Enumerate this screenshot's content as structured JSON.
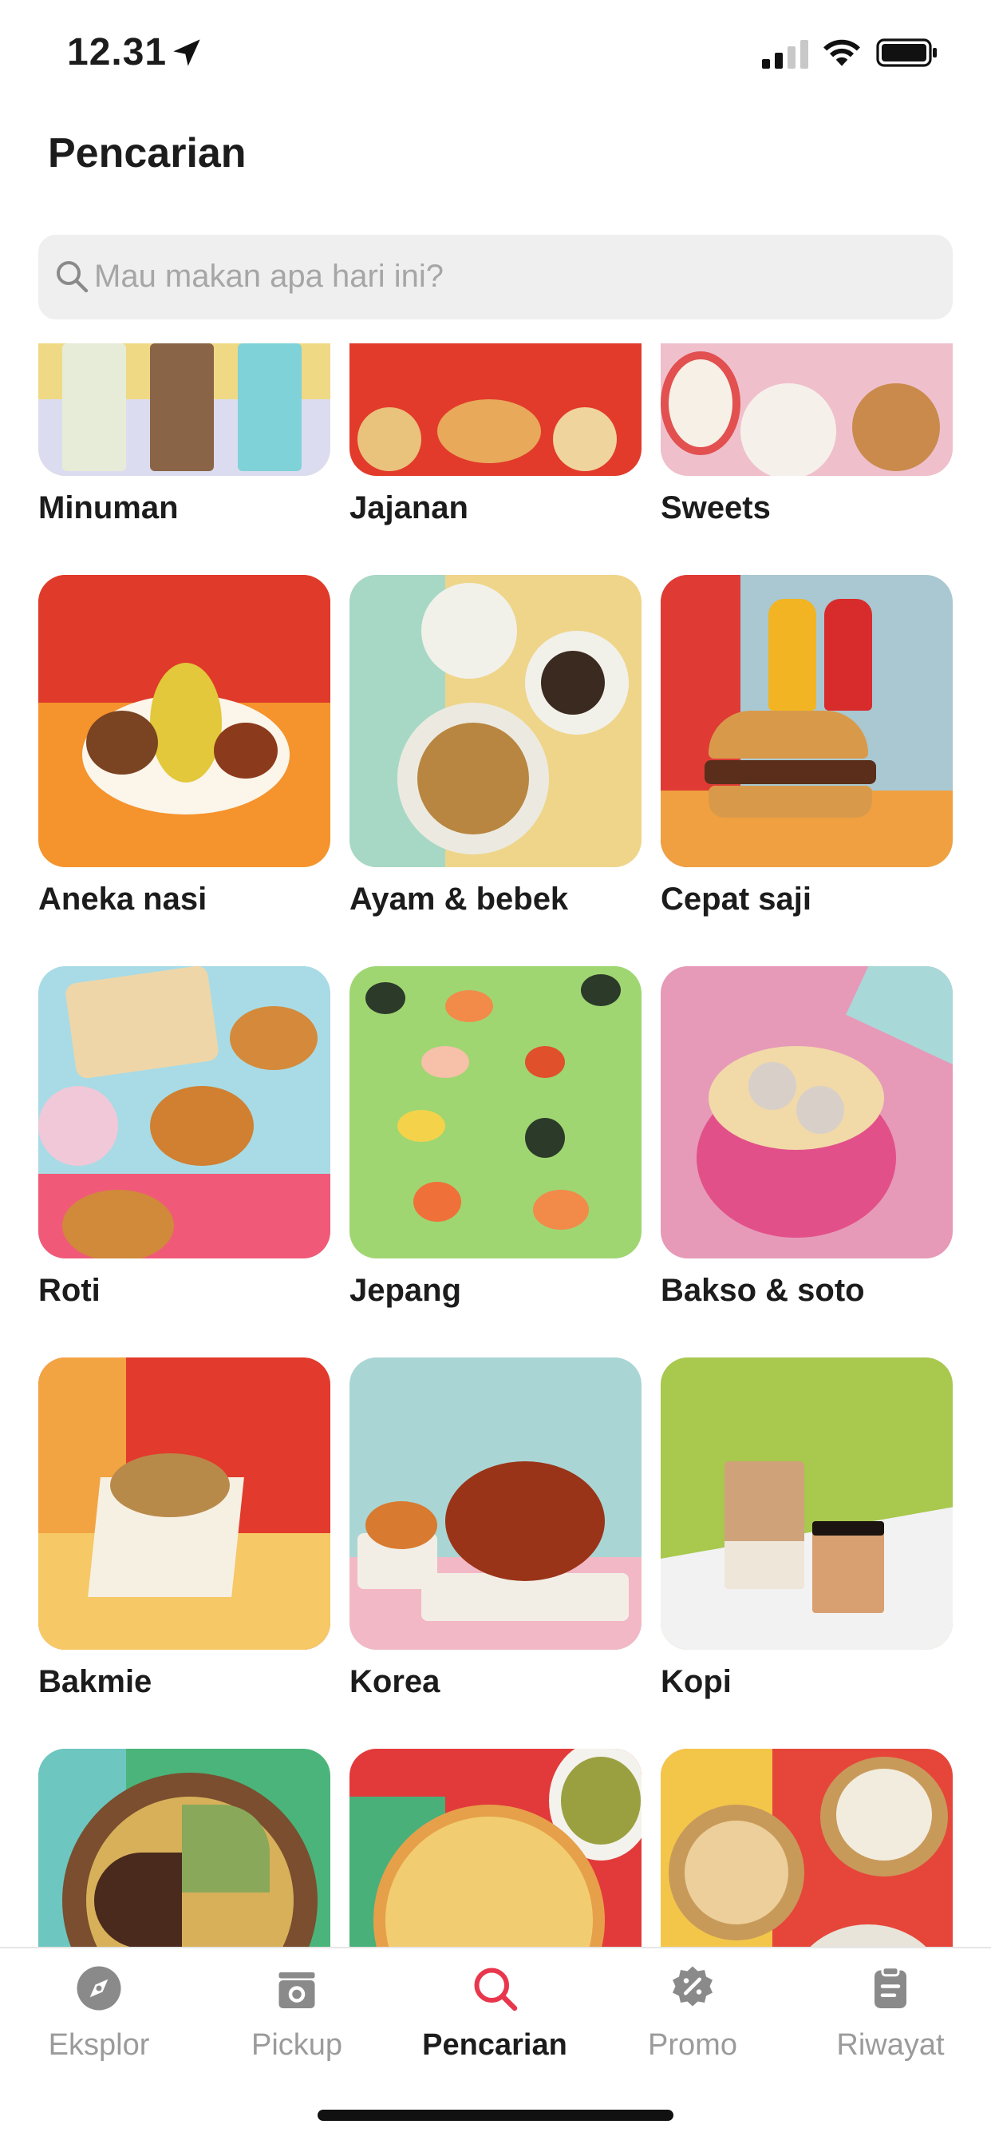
{
  "status_bar": {
    "time": "12.31"
  },
  "header": {
    "title": "Pencarian"
  },
  "search": {
    "placeholder": "Mau makan apa hari ini?"
  },
  "categories": [
    {
      "label": "Minuman"
    },
    {
      "label": "Jajanan"
    },
    {
      "label": "Sweets"
    },
    {
      "label": "Aneka nasi"
    },
    {
      "label": "Ayam & bebek"
    },
    {
      "label": "Cepat saji"
    },
    {
      "label": "Roti"
    },
    {
      "label": "Jepang"
    },
    {
      "label": "Bakso & soto"
    },
    {
      "label": "Bakmie"
    },
    {
      "label": "Korea"
    },
    {
      "label": "Kopi"
    }
  ],
  "bottom_nav": {
    "items": [
      {
        "label": "Eksplor",
        "icon": "compass-icon"
      },
      {
        "label": "Pickup",
        "icon": "pickup-bag-icon"
      },
      {
        "label": "Pencarian",
        "icon": "search-icon",
        "active": true
      },
      {
        "label": "Promo",
        "icon": "promo-percent-icon"
      },
      {
        "label": "Riwayat",
        "icon": "history-clipboard-icon"
      }
    ]
  },
  "colors": {
    "accent": "#e8374d",
    "inactive": "#9b9b9b",
    "search_bg": "#efefef"
  }
}
